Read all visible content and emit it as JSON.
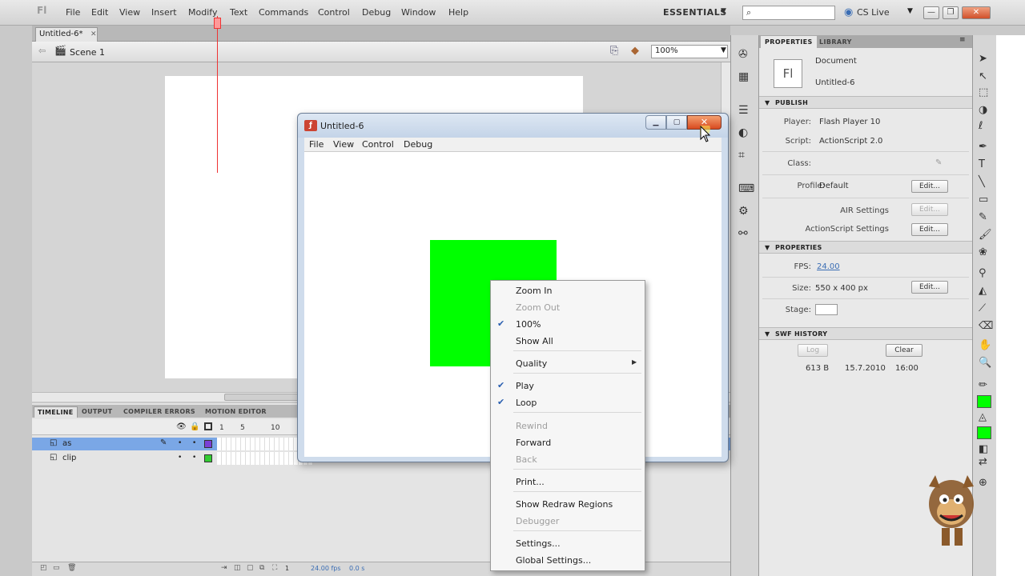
{
  "app": {
    "logo": "Fl",
    "menu": [
      "File",
      "Edit",
      "View",
      "Insert",
      "Modify",
      "Text",
      "Commands",
      "Control",
      "Debug",
      "Window",
      "Help"
    ],
    "workspace": "ESSENTIALS",
    "cslive": "CS Live",
    "search_placeholder": "",
    "window_controls": [
      "—",
      "❐",
      "✕"
    ]
  },
  "document": {
    "tab": "Untitled-6*",
    "scene": "Scene 1",
    "zoom": "100%"
  },
  "timeline": {
    "tabs": [
      "TIMELINE",
      "OUTPUT",
      "COMPILER ERRORS",
      "MOTION EDITOR"
    ],
    "frame_numbers": [
      "1",
      "5",
      "10"
    ],
    "layers": [
      {
        "name": "as",
        "color": "#7b3fd6",
        "selected": true
      },
      {
        "name": "clip",
        "color": "#33cc33",
        "selected": false
      }
    ],
    "footer": {
      "frame": "1",
      "fps": "24.00 fps",
      "time": "0.0 s"
    }
  },
  "properties": {
    "tabs": [
      "PROPERTIES",
      "LIBRARY"
    ],
    "doc_icon": "Fl",
    "doc_type": "Document",
    "doc_name": "Untitled-6",
    "publish": {
      "header": "PUBLISH",
      "player_label": "Player:",
      "player_value": "Flash Player 10",
      "script_label": "Script:",
      "script_value": "ActionScript 2.0",
      "class_label": "Class:",
      "profile_label": "Profile:",
      "profile_value": "Default",
      "edit_label": "Edit...",
      "air_settings": "AIR Settings",
      "as_settings": "ActionScript Settings"
    },
    "props_section": {
      "header": "PROPERTIES",
      "fps_label": "FPS:",
      "fps_value": "24.00",
      "size_label": "Size:",
      "size_value": "550 x 400 px",
      "stage_label": "Stage:",
      "stage_color": "#ffffff"
    },
    "swf_history": {
      "header": "SWF HISTORY",
      "log_label": "Log",
      "clear_label": "Clear",
      "entry_size": "613 B",
      "entry_date": "15.7.2010",
      "entry_time": "16:00"
    }
  },
  "player": {
    "title": "Untitled-6",
    "menu": [
      "File",
      "View",
      "Control",
      "Debug"
    ],
    "shape_color": "#00ff00"
  },
  "context_menu": {
    "items": [
      {
        "label": "Zoom In",
        "disabled": false,
        "checked": false
      },
      {
        "label": "Zoom Out",
        "disabled": true,
        "checked": false
      },
      {
        "label": "100%",
        "disabled": false,
        "checked": true
      },
      {
        "label": "Show All",
        "disabled": false,
        "checked": false
      },
      {
        "label": "Quality",
        "disabled": false,
        "checked": false,
        "submenu": true
      },
      {
        "label": "Play",
        "disabled": false,
        "checked": true
      },
      {
        "label": "Loop",
        "disabled": false,
        "checked": true
      },
      {
        "label": "Rewind",
        "disabled": true,
        "checked": false
      },
      {
        "label": "Forward",
        "disabled": false,
        "checked": false
      },
      {
        "label": "Back",
        "disabled": true,
        "checked": false
      },
      {
        "label": "Print...",
        "disabled": false,
        "checked": false
      },
      {
        "label": "Show Redraw Regions",
        "disabled": false,
        "checked": false
      },
      {
        "label": "Debugger",
        "disabled": true,
        "checked": false
      },
      {
        "label": "Settings...",
        "disabled": false,
        "checked": false
      },
      {
        "label": "Global Settings...",
        "disabled": false,
        "checked": false
      }
    ]
  },
  "colors": {
    "accent_green": "#00ff00",
    "selection_blue": "#7aa7e6",
    "playhead_red": "#e33333"
  }
}
